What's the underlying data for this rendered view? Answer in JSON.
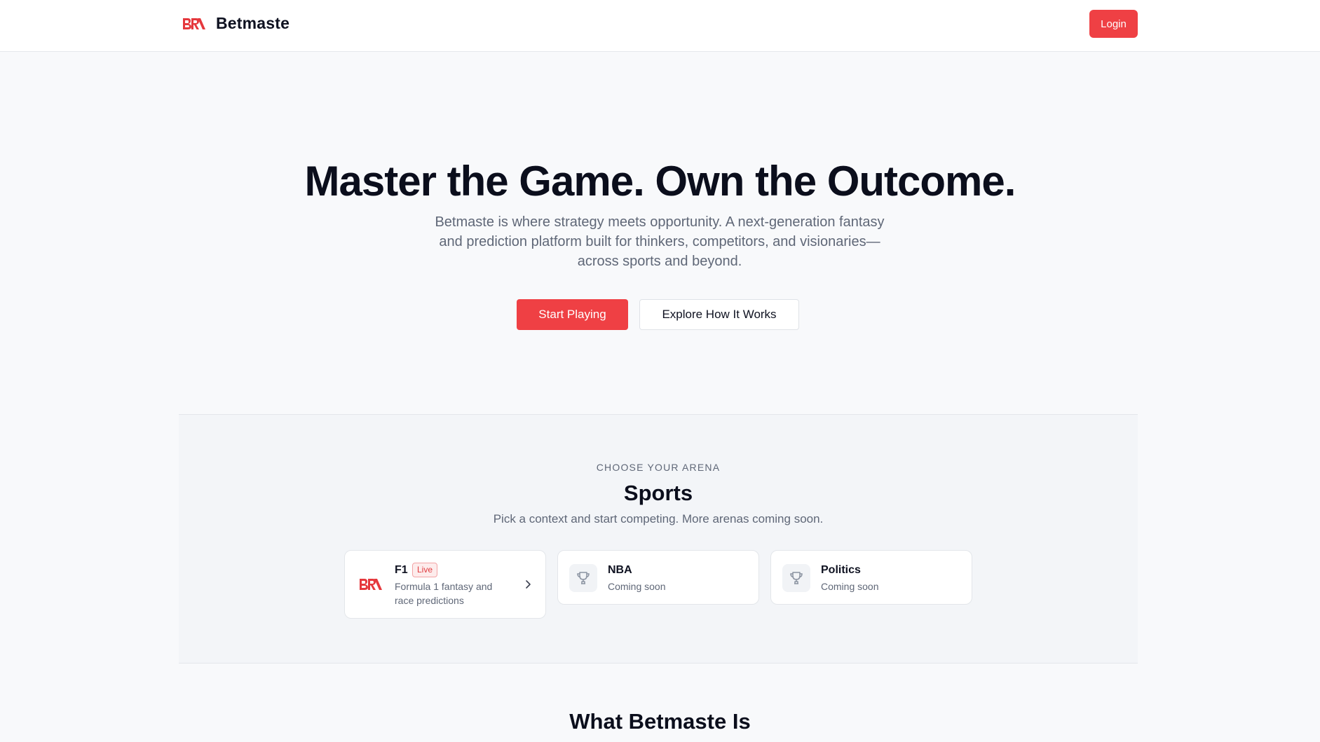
{
  "header": {
    "brand_name": "Betmaste",
    "login_label": "Login"
  },
  "hero": {
    "title": "Master the Game. Own the Outcome.",
    "subtitle": "Betmaste is where strategy meets opportunity. A next-generation fantasy and prediction platform built for thinkers, competitors, and visionaries—across sports and beyond.",
    "primary_cta": "Start Playing",
    "secondary_cta": "Explore How It Works"
  },
  "arena": {
    "eyebrow": "CHOOSE YOUR ARENA",
    "title": "Sports",
    "subtitle": "Pick a context and start competing. More arenas coming soon.",
    "cards": [
      {
        "title": "F1",
        "badge": "Live",
        "description": "Formula 1 fantasy and race predictions",
        "icon": "brand-logo-icon"
      },
      {
        "title": "NBA",
        "description": "Coming soon",
        "icon": "trophy-icon"
      },
      {
        "title": "Politics",
        "description": "Coming soon",
        "icon": "trophy-icon"
      }
    ]
  },
  "section": {
    "heading": "What Betmaste Is"
  },
  "colors": {
    "accent": "#ef4044",
    "background": "#f8f9fb",
    "text_primary": "#0b0e1c",
    "text_muted": "#5f6777"
  }
}
